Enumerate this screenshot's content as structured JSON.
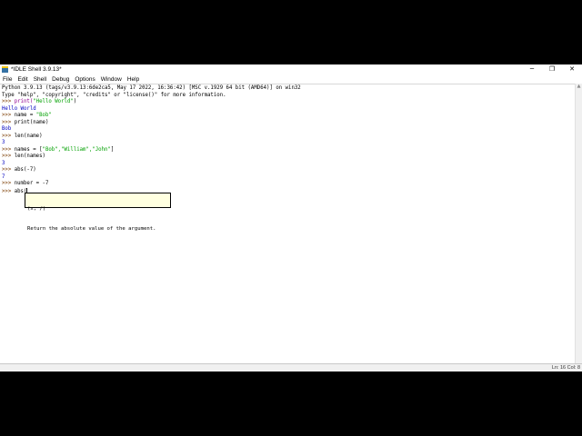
{
  "window": {
    "title": "*IDLE Shell 3.9.13*",
    "controls": {
      "minimize": "─",
      "maximize": "❐",
      "close": "✕"
    }
  },
  "menubar": {
    "items": [
      "File",
      "Edit",
      "Shell",
      "Debug",
      "Options",
      "Window",
      "Help"
    ]
  },
  "shell": {
    "banner1": "Python 3.9.13 (tags/v3.9.13:6de2ca5, May 17 2022, 16:36:42) [MSC v.1929 64 bit (AMD64)] on win32",
    "banner2": "Type \"help\", \"copyright\", \"credits\" or \"license()\" for more information.",
    "lines": [
      {
        "prompt": ">>> ",
        "code_pre": "print(",
        "code_str": "\"Hello World\"",
        "code_post": ")"
      },
      {
        "output": "Hello World"
      },
      {
        "prompt": ">>> ",
        "code_pre": "name = ",
        "code_str": "\"Bob\"",
        "code_post": ""
      },
      {
        "prompt": ">>> ",
        "code_pre": "print(name)",
        "code_str": "",
        "code_post": ""
      },
      {
        "output": "Bob"
      },
      {
        "prompt": ">>> ",
        "code_pre": "len(name)",
        "code_str": "",
        "code_post": ""
      },
      {
        "output": "3"
      },
      {
        "prompt": ">>> ",
        "code_pre": "names = [",
        "code_str": "\"Bob\",\"William\",\"John\"",
        "code_post": "]"
      },
      {
        "prompt": ">>> ",
        "code_pre": "len(names)",
        "code_str": "",
        "code_post": ""
      },
      {
        "output": "3"
      },
      {
        "prompt": ">>> ",
        "code_pre": "abs(-7)",
        "code_str": "",
        "code_post": ""
      },
      {
        "output": "7"
      },
      {
        "prompt": ">>> ",
        "code_pre": "number = -7",
        "code_str": "",
        "code_post": ""
      },
      {
        "prompt": ">>> ",
        "code_pre": "abs(",
        "code_str": "",
        "code_post": ""
      }
    ]
  },
  "calltip": {
    "signature": "(x, /)",
    "description": "Return the absolute value of the argument."
  },
  "statusbar": {
    "position": "Ln: 16   Col: 8"
  }
}
